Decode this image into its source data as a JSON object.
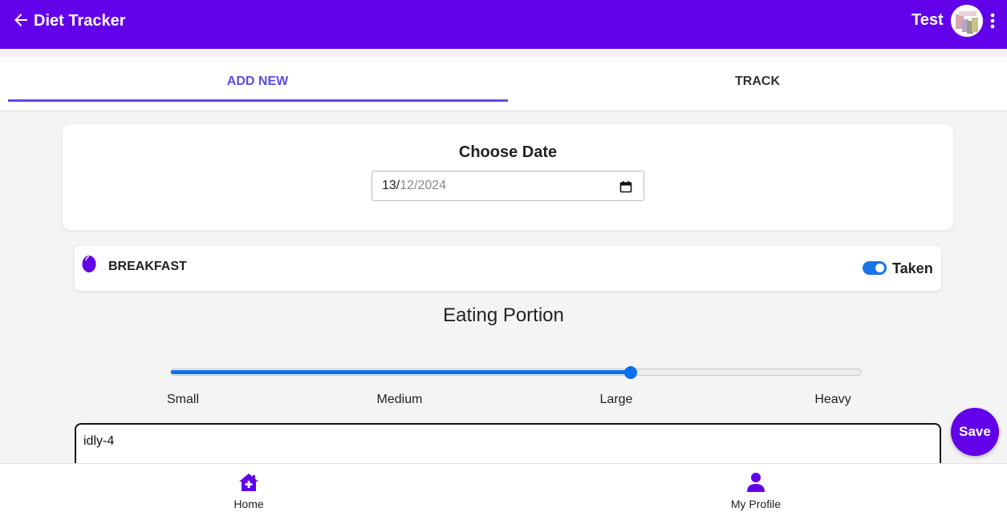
{
  "header": {
    "title": "Diet Tracker",
    "user_name": "Test",
    "back_icon": "arrow-left-icon",
    "menu_icon": "kebab-menu-icon",
    "bg_color": "#6200ea"
  },
  "tabs": [
    {
      "label": "ADD NEW",
      "active": true
    },
    {
      "label": "TRACK",
      "active": false
    }
  ],
  "date_picker": {
    "title": "Choose Date",
    "day": "13/",
    "month_year": "12/2024"
  },
  "meal": {
    "name": "BREAKFAST",
    "icon": "egg-icon",
    "taken_label": "Taken",
    "taken": true
  },
  "portion": {
    "title": "Eating Portion",
    "labels": [
      "Small",
      "Medium",
      "Large",
      "Heavy"
    ],
    "selected": "Large",
    "level": 0.667
  },
  "notes": {
    "value": "idly-4"
  },
  "save_label": "Save",
  "nav": {
    "home_label": "Home",
    "profile_label": "My Profile"
  },
  "colors": {
    "primary": "#6200ea",
    "accent": "#5b4ae6",
    "slider": "#0b6ff0"
  }
}
